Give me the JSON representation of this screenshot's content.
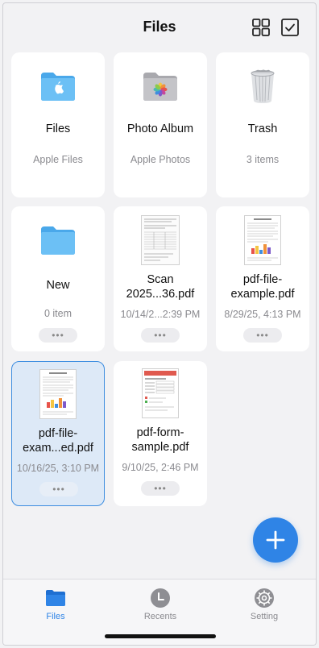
{
  "header": {
    "title": "Files",
    "grid_icon": "grid-view-icon",
    "select_icon": "checkbox-select-icon"
  },
  "items": [
    {
      "name": "Files",
      "sub": "Apple Files",
      "icon": "folder-apple-icon"
    },
    {
      "name": "Photo Album",
      "sub": "Apple Photos",
      "icon": "folder-photos-icon"
    },
    {
      "name": "Trash",
      "sub": "3 items",
      "icon": "trash-bin-icon"
    },
    {
      "name": "New",
      "sub": "0 item",
      "icon": "folder-icon",
      "more": "•••"
    },
    {
      "name": "Scan 2025...36.pdf",
      "sub": "10/14/2...2:39 PM",
      "icon": "scan-thumbnail",
      "more": "•••"
    },
    {
      "name": "pdf-file-example.pdf",
      "sub": "8/29/25, 4:13 PM",
      "icon": "pdf-thumbnail",
      "more": "•••"
    },
    {
      "name": "pdf-file-exam...ed.pdf",
      "sub": "10/16/25, 3:10 PM",
      "icon": "pdf-thumbnail",
      "more": "•••",
      "selected": true
    },
    {
      "name": "pdf-form-sample.pdf",
      "sub": "9/10/25, 2:46 PM",
      "icon": "pdf-form-thumbnail",
      "more": "•••"
    }
  ],
  "fab": {
    "icon": "plus-icon"
  },
  "tabs": [
    {
      "label": "Files",
      "icon": "folder-tab-icon",
      "active": true
    },
    {
      "label": "Recents",
      "icon": "clock-icon"
    },
    {
      "label": "Setting",
      "icon": "gear-icon"
    }
  ],
  "colors": {
    "accent": "#2f84e6",
    "folder": "#5ab4f2",
    "selected_bg": "#dde9f7"
  }
}
